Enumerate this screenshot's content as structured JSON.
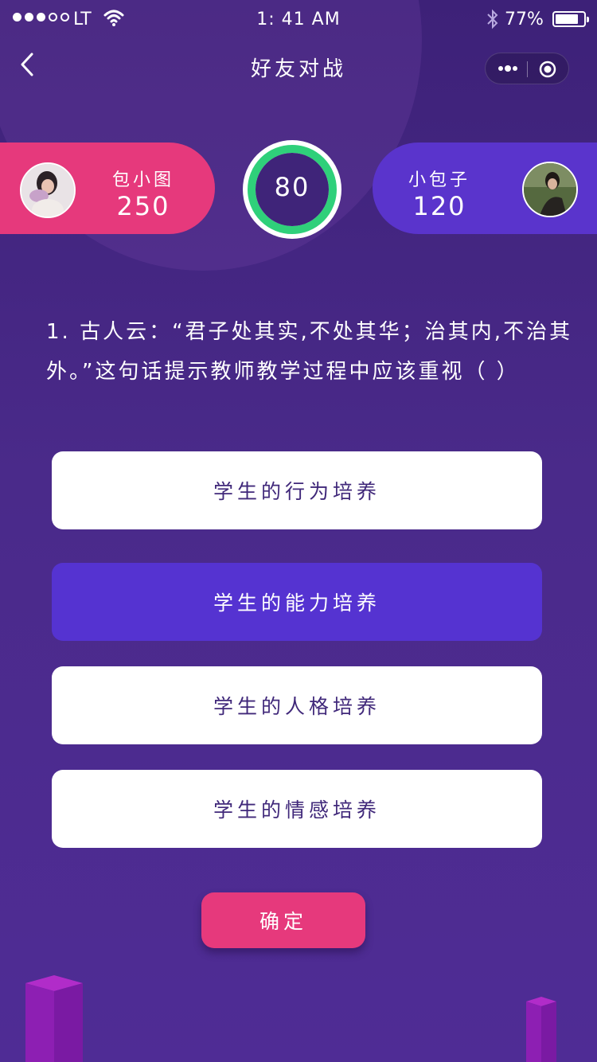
{
  "status_bar": {
    "signal_filled": 3,
    "signal_total": 5,
    "carrier": "LT",
    "time": "1: 41 AM",
    "battery_percent": "77%",
    "battery_level": 0.77,
    "icons": [
      "wifi-icon",
      "bluetooth-icon",
      "battery-icon"
    ]
  },
  "nav": {
    "title": "好友对战",
    "back_icon": "chevron-left-icon",
    "more_icon": "more-dots-icon",
    "close_icon": "target-circle-icon"
  },
  "battle": {
    "player_left": {
      "name": "包小图",
      "score": "250"
    },
    "player_right": {
      "name": "小包子",
      "score": "120"
    },
    "timer": "80"
  },
  "question": {
    "text": "1. 古人云：“君子处其实,不处其华；治其内,不治其外。”这句话提示教师教学过程中应该重视（    ）"
  },
  "options": [
    {
      "label": "学生的行为培养",
      "selected": false
    },
    {
      "label": "学生的能力培养",
      "selected": true
    },
    {
      "label": "学生的人格培养",
      "selected": false
    },
    {
      "label": "学生的情感培养",
      "selected": false
    }
  ],
  "confirm_label": "确定",
  "colors": {
    "background_top": "#3d2178",
    "background_bottom": "#4f2c95",
    "left_card": "#e6397c",
    "right_card": "#5a34cc",
    "timer_ring": "#2fd07a",
    "selected_option": "#5533d1",
    "option_text": "#40287a",
    "confirm_button": "#e6397c"
  }
}
